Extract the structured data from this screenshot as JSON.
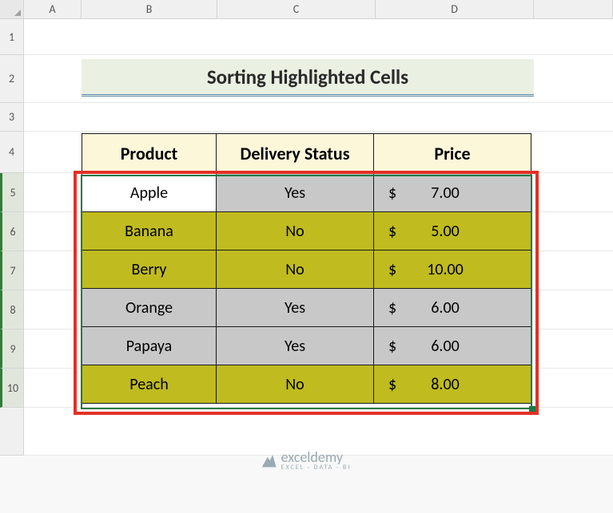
{
  "columns": [
    "A",
    "B",
    "C",
    "D"
  ],
  "rows": [
    "1",
    "2",
    "3",
    "4",
    "5",
    "6",
    "7",
    "8",
    "9",
    "10"
  ],
  "title": "Sorting Highlighted Cells",
  "headers": {
    "product": "Product",
    "delivery": "Delivery Status",
    "price": "Price"
  },
  "currency": "$",
  "data": [
    {
      "product": "Apple",
      "delivery": "Yes",
      "price": "7.00",
      "fillA": "white",
      "fillB": "gray",
      "fillC": "gray"
    },
    {
      "product": "Banana",
      "delivery": "No",
      "price": "5.00",
      "fillA": "olive",
      "fillB": "olive",
      "fillC": "olive"
    },
    {
      "product": "Berry",
      "delivery": "No",
      "price": "10.00",
      "fillA": "olive",
      "fillB": "olive",
      "fillC": "olive"
    },
    {
      "product": "Orange",
      "delivery": "Yes",
      "price": "6.00",
      "fillA": "gray",
      "fillB": "gray",
      "fillC": "gray"
    },
    {
      "product": "Papaya",
      "delivery": "Yes",
      "price": "6.00",
      "fillA": "gray",
      "fillB": "gray",
      "fillC": "gray"
    },
    {
      "product": "Peach",
      "delivery": "No",
      "price": "8.00",
      "fillA": "olive",
      "fillB": "olive",
      "fillC": "olive"
    }
  ],
  "watermark": {
    "brand": "exceldemy",
    "tagline": "EXCEL · DATA · BI"
  }
}
